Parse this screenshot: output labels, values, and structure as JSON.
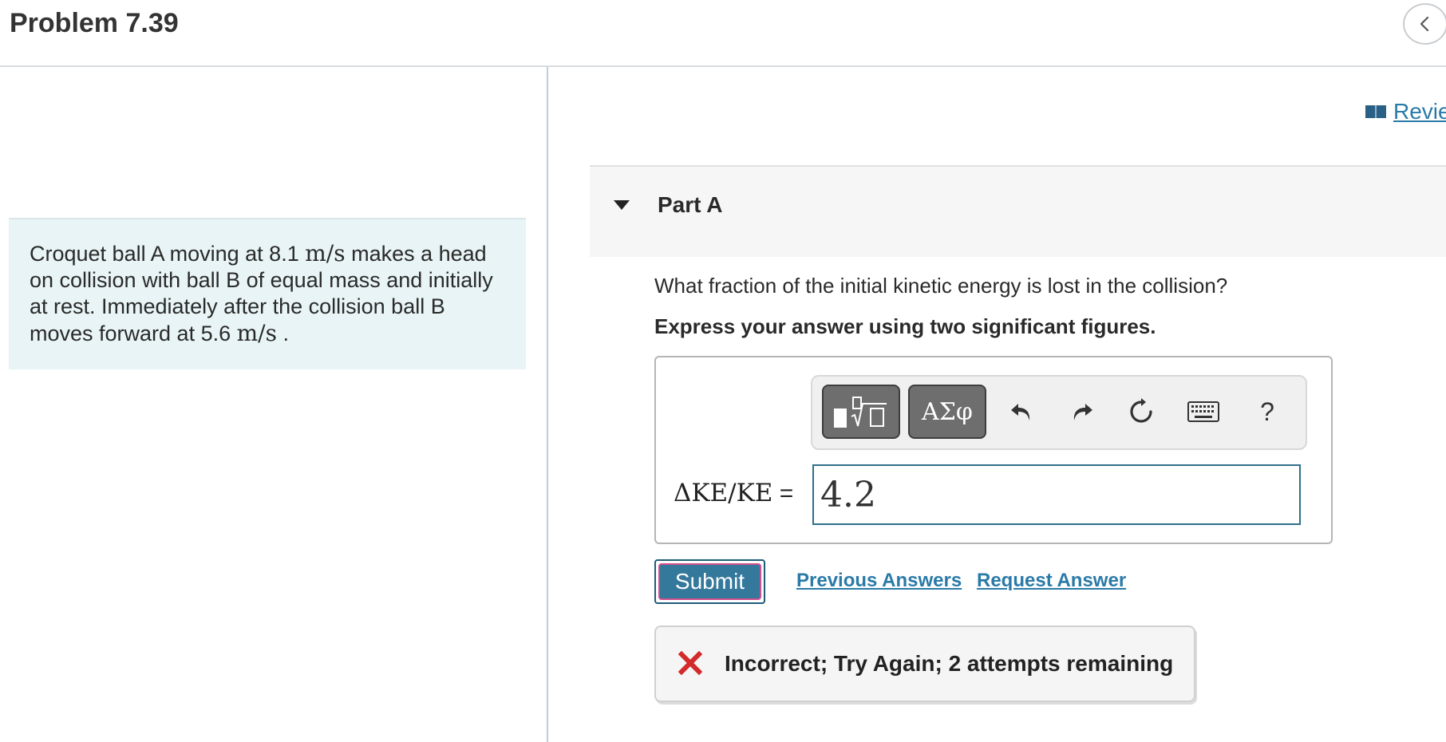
{
  "header": {
    "title": "Problem 7.39"
  },
  "problem": {
    "text_1": "Croquet ball A moving at 8.1 ",
    "unit_1": "m/s",
    "text_2": " makes a head on collision with ball B of equal mass and initially at rest. Immediately after the collision ball B moves forward at 5.6 ",
    "unit_2": "m/s",
    "text_3": " ."
  },
  "review": {
    "label": "Revie"
  },
  "part": {
    "title": "Part A",
    "question": "What fraction of the initial kinetic energy is lost in the collision?",
    "instruction": "Express your answer using two significant figures."
  },
  "toolbar": {
    "symbols_label": "ΑΣφ",
    "help_label": "?"
  },
  "answer": {
    "label": "ΔKE/KE",
    "equals": " =",
    "value": "4.2"
  },
  "actions": {
    "submit_label": "Submit",
    "previous_answers_label": "Previous Answers",
    "request_answer_label": "Request Answer"
  },
  "feedback": {
    "message": "Incorrect; Try Again; 2 attempts remaining"
  },
  "colors": {
    "link": "#2a7aa8",
    "submit_bg": "#34789b",
    "error_x": "#d42a2a",
    "problem_bg": "#e8f4f5"
  }
}
